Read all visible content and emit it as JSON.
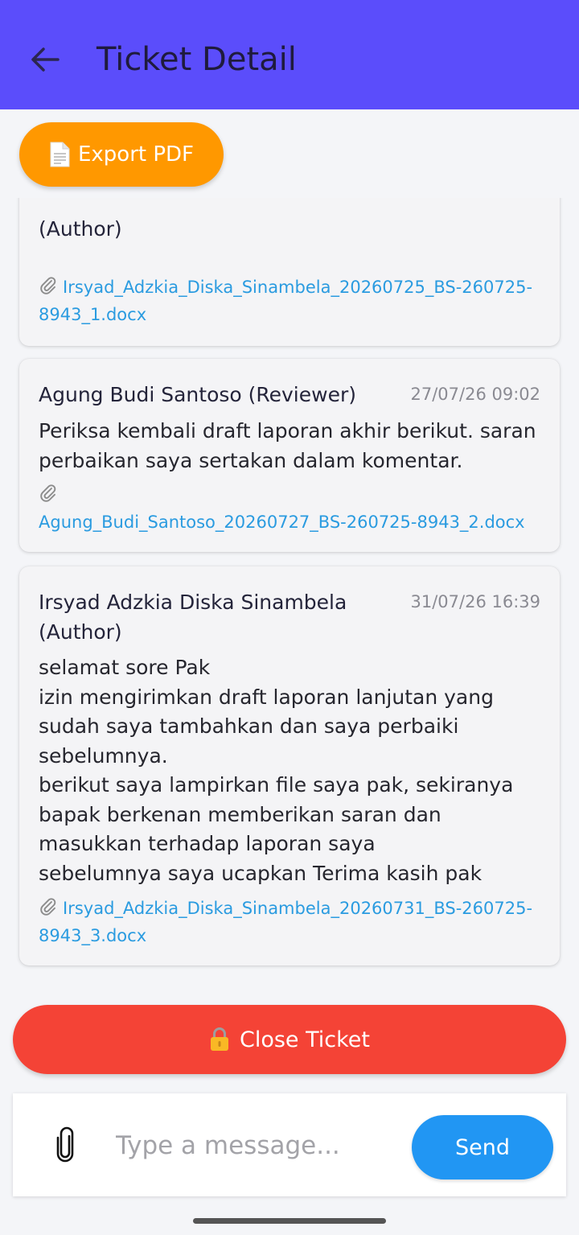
{
  "header": {
    "title": "Ticket Detail",
    "color": "#5b4dfb"
  },
  "export_button": {
    "label": "Export PDF",
    "color": "#ff9800"
  },
  "messages": [
    {
      "author": "(Author)",
      "time": "",
      "body": [],
      "attachment": "Irsyad_Adzkia_Diska_Sinambela_20260725_BS-260725-8943_1.docx"
    },
    {
      "author": "Agung Budi Santoso (Reviewer)",
      "time": "27/07/26 09:02",
      "body": [
        "Periksa kembali draft laporan akhir berikut. saran",
        "perbaikan saya sertakan dalam komentar."
      ],
      "attachment": "Agung_Budi_Santoso_20260727_BS-260725-8943_2.docx"
    },
    {
      "author": "Irsyad Adzkia Diska Sinambela (Author)",
      "time": "31/07/26 16:39",
      "body": [
        "selamat sore Pak",
        "izin mengirimkan draft laporan lanjutan yang",
        "sudah saya tambahkan dan saya perbaiki",
        "sebelumnya.",
        "berikut saya lampirkan file saya pak, sekiranya",
        "bapak berkenan memberikan saran dan",
        "masukkan terhadap laporan saya",
        "sebelumnya saya ucapkan Terima kasih pak"
      ],
      "attachment": "Irsyad_Adzkia_Diska_Sinambela_20260731_BS-260725-8943_3.docx"
    }
  ],
  "close_button": {
    "label": "Close Ticket",
    "color": "#f44336"
  },
  "composer": {
    "placeholder": "Type a message...",
    "send_label": "Send",
    "send_color": "#2196f3"
  },
  "icons": {
    "back": "arrow-left-icon",
    "export": "document-icon",
    "attachment": "paperclip-icon",
    "close": "lock-icon"
  }
}
